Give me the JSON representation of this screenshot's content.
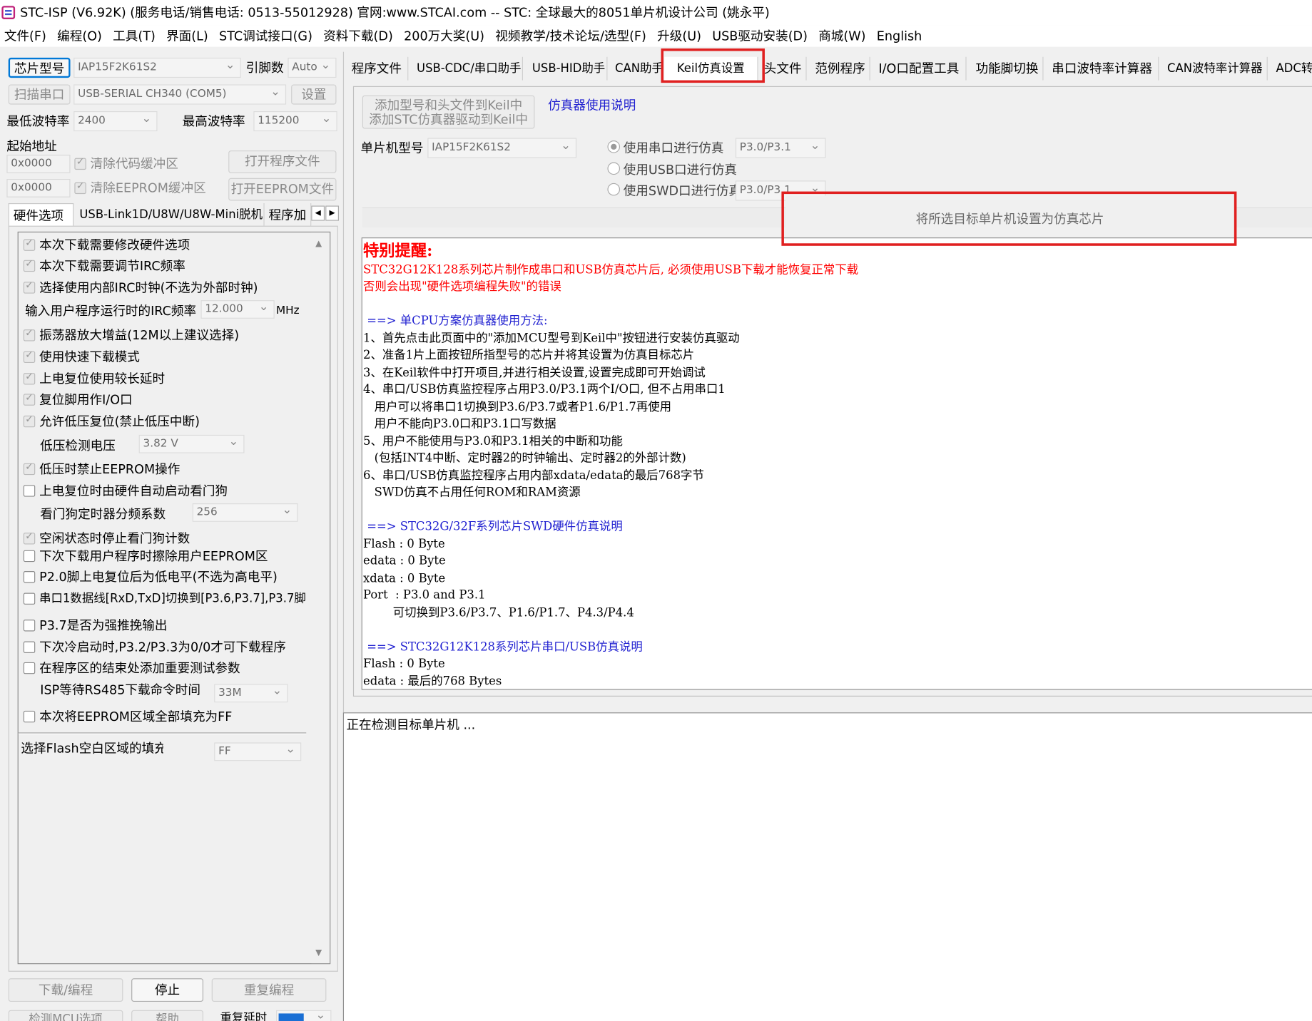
{
  "title": "STC-ISP (V6.92K) (服务电话/销售电话: 0513-55012928) 官网:www.STCAI.com  -- STC: 全球最大的8051单片机设计公司 (姚永平)",
  "menu": [
    "文件(F)",
    "编程(O)",
    "工具(T)",
    "界面(L)",
    "STC调试接口(G)",
    "资料下载(D)",
    "200万大奖(U)",
    "视频教学/技术论坛/选型(F)",
    "升级(U)",
    "USB驱动安装(D)",
    "商城(W)",
    "English"
  ],
  "left": {
    "chip_label": "芯片型号",
    "chip_value": "IAP15F2K61S2",
    "pins_label": "引脚数",
    "pins_value": "Auto",
    "scan_label": "扫描串口",
    "port_value": "USB-SERIAL CH340 (COM5)",
    "settings_label": "设置",
    "min_baud_label": "最低波特率",
    "min_baud_value": "2400",
    "max_baud_label": "最高波特率",
    "max_baud_value": "115200",
    "start_addr_label": "起始地址",
    "addr1": "0x0000",
    "clear_code": "清除代码缓冲区",
    "open_prog": "打开程序文件",
    "addr2": "0x0000",
    "clear_eeprom": "清除EEPROM缓冲区",
    "open_eeprom": "打开EEPROM文件",
    "subtabs": [
      "硬件选项",
      "USB-Link1D/U8W/U8W-Mini脱机",
      "程序加"
    ],
    "options": [
      {
        "label": "本次下载需要修改硬件选项",
        "checked": true
      },
      {
        "label": "本次下载需要调节IRC频率",
        "checked": true
      },
      {
        "label": "选择使用内部IRC时钟(不选为外部时钟)",
        "checked": true
      },
      {
        "label": "振荡器放大增益(12M以上建议选择)",
        "checked": true
      },
      {
        "label": "使用快速下载模式",
        "checked": true
      },
      {
        "label": "上电复位使用较长延时",
        "checked": true
      },
      {
        "label": "复位脚用作I/O口",
        "checked": true
      },
      {
        "label": "允许低压复位(禁止低压中断)",
        "checked": true
      },
      {
        "label": "低压时禁止EEPROM操作",
        "checked": true
      },
      {
        "label": "上电复位时由硬件自动启动看门狗",
        "checked": false
      },
      {
        "label": "空闲状态时停止看门狗计数",
        "checked": true
      },
      {
        "label": "下次下载用户程序时擦除用户EEPROM区",
        "checked": false
      },
      {
        "label": "P2.0脚上电复位后为低电平(不选为高电平)",
        "checked": false
      },
      {
        "label": "串口1数据线[RxD,TxD]切换到[P3.6,P3.7],P3.7脚",
        "checked": false
      },
      {
        "label": "P3.7是否为强推挽输出",
        "checked": false
      },
      {
        "label": "下次冷启动时,P3.2/P3.3为0/0才可下载程序",
        "checked": false
      },
      {
        "label": "在程序区的结束处添加重要测试参数",
        "checked": false
      },
      {
        "label": "本次将EEPROM区域全部填充为FF",
        "checked": false
      }
    ],
    "irc_label": "输入用户程序运行时的IRC频率",
    "irc_value": "12.000",
    "irc_unit": "MHz",
    "lvd_label": "低压检测电压",
    "lvd_value": "3.82 V",
    "wdt_label": "看门狗定时器分频系数",
    "wdt_value": "256",
    "rs485_label": "ISP等待RS485下载命令时间",
    "rs485_value": "33M",
    "flash_fill_label": "选择Flash空白区域的填充",
    "flash_fill_value": "FF",
    "download_btn": "下载/编程",
    "stop_btn": "停止",
    "reprog_btn": "重复编程",
    "detect_btn": "检测MCU选项",
    "help_btn": "帮助",
    "repeat_delay_label": "重复延时"
  },
  "right": {
    "tabs": [
      "程序文件",
      "USB-CDC/串口助手",
      "USB-HID助手",
      "CAN助手",
      "Keil仿真设置",
      "头文件",
      "范例程序",
      "I/O口配置工具",
      "功能脚切换",
      "串口波特率计算器",
      "CAN波特率计算器",
      "ADC转换"
    ],
    "add_keil_1": "添加型号和头文件到Keil中",
    "add_keil_2": "添加STC仿真器驱动到Keil中",
    "emu_manual": "仿真器使用说明",
    "mcu_label": "单片机型号",
    "mcu_value": "IAP15F2K61S2",
    "radio_serial": "使用串口进行仿真",
    "serial_port": "P3.0/P3.1",
    "radio_usb": "使用USB口进行仿真",
    "radio_swd": "使用SWD口进行仿真",
    "swd_port": "P3.0/P3.1",
    "set_emu_btn": "将所选目标单片机设置为仿真芯片",
    "notice_title": "特别提醒:",
    "red_line1": "STC32G12K128系列芯片制作成串口和USB仿真芯片后, 必须使用USB下载才能恢复正常下载",
    "red_line2": "否则会出现\"硬件选项编程失败\"的错误",
    "h1": " ==> 单CPU方案仿真器使用方法:",
    "l1": "1、首先点击此页面中的\"添加MCU型号到Keil中\"按钮进行安装仿真驱动",
    "l2": "2、准备1片上面按钮所指型号的芯片并将其设置为仿真目标芯片",
    "l3": "3、在Keil软件中打开项目,并进行相关设置,设置完成即可开始调试",
    "l4": "4、串口/USB仿真监控程序占用P3.0/P3.1两个I/O口, 但不占用串口1",
    "l5": "   用户可以将串口1切换到P3.6/P3.7或者P1.6/P1.7再使用",
    "l6": "   用户不能向P3.0口和P3.1口写数据",
    "l7": "5、用户不能使用与P3.0和P3.1相关的中断和功能",
    "l8": "   (包括INT4中断、定时器2的时钟输出、定时器2的外部计数)",
    "l9": "6、串口/USB仿真监控程序占用内部xdata/edata的最后768字节",
    "l10": "   SWD仿真不占用任何ROM和RAM资源",
    "h2": " ==> STC32G/32F系列芯片SWD硬件仿真说明",
    "l11": "Flash : 0 Byte",
    "l12": "edata : 0 Byte",
    "l13": "xdata : 0 Byte",
    "l14": "Port  : P3.0 and P3.1",
    "l15": "        可切换到P3.6/P3.7、P1.6/P1.7、P4.3/P4.4",
    "h3": " ==> STC32G12K128系列芯片串口/USB仿真说明",
    "l16": "Flash : 0 Byte",
    "l17": "edata : 最后的768 Bytes",
    "status": "正在检测目标单片机 ..."
  },
  "colors": {
    "highlight": "#e02020",
    "link": "#1f1fd0",
    "warning": "#ff0000"
  }
}
